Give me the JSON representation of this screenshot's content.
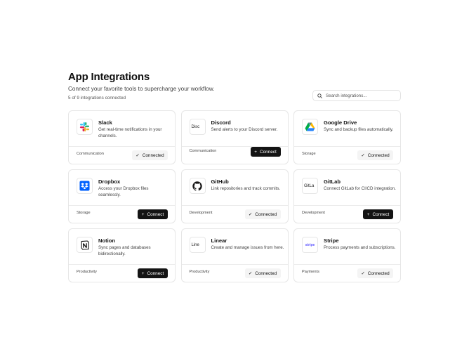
{
  "header": {
    "title": "App Integrations",
    "subtitle": "Connect your favorite tools to supercharge your workflow.",
    "count": "5 of 9 integrations connected"
  },
  "search": {
    "placeholder": "Search integrations...",
    "value": "",
    "icon": "search-icon"
  },
  "labels": {
    "connected": "Connected",
    "connect": "Connect"
  },
  "integrations": [
    {
      "name": "Slack",
      "description": "Get real-time notifications in your channels.",
      "category": "Communication",
      "connected": true,
      "icon": "slack-logo"
    },
    {
      "name": "Discord",
      "description": "Send alerts to your Discord server.",
      "category": "Communication",
      "connected": false,
      "icon": "discord-logo",
      "logo_alt": "Disc"
    },
    {
      "name": "Google Drive",
      "description": "Sync and backup files automatically.",
      "category": "Storage",
      "connected": true,
      "icon": "google-drive-logo"
    },
    {
      "name": "Dropbox",
      "description": "Access your Dropbox files seamlessly.",
      "category": "Storage",
      "connected": false,
      "icon": "dropbox-logo"
    },
    {
      "name": "GitHub",
      "description": "Link repositories and track commits.",
      "category": "Development",
      "connected": true,
      "icon": "github-logo"
    },
    {
      "name": "GitLab",
      "description": "Connect GitLab for CI/CD integration.",
      "category": "Development",
      "connected": false,
      "icon": "gitlab-logo",
      "logo_alt": "GitLa"
    },
    {
      "name": "Notion",
      "description": "Sync pages and databases bidirectionally.",
      "category": "Productivity",
      "connected": false,
      "icon": "notion-logo"
    },
    {
      "name": "Linear",
      "description": "Create and manage issues from here.",
      "category": "Productivity",
      "connected": true,
      "icon": "linear-logo",
      "logo_alt": "Line"
    },
    {
      "name": "Stripe",
      "description": "Process payments and subscriptions.",
      "category": "Payments",
      "connected": true,
      "icon": "stripe-logo",
      "logo_alt": "stripe"
    }
  ]
}
